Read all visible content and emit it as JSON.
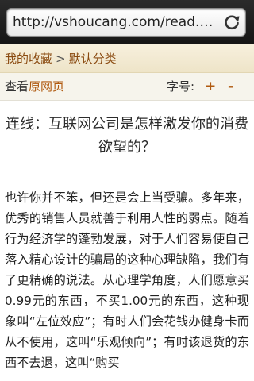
{
  "browser": {
    "url": "http://vshoucang.com/read.php?sid...",
    "reload_icon": "reload-icon"
  },
  "breadcrumb": {
    "home": "我的收藏",
    "separator": ">",
    "current": "默认分类"
  },
  "toolbar": {
    "view_prefix": "查看",
    "view_link": "原网页",
    "font_size_label": "字号:",
    "increase": "+",
    "decrease": "-"
  },
  "article": {
    "title": "连线：互联网公司是怎样激发你的消费欲望的？",
    "body": "也许你并不笨，但还是会上当受骗。多年来，优秀的销售人员就善于利用人性的弱点。随着行为经济学的蓬勃发展，对于人们容易使自己落入精心设计的骗局的这种心理缺陷，我们有了更精确的说法。从心理学角度，人们愿意买0.99元的东西，不买1.00元的东西，这种现象叫“左位效应”；有时人们会花钱办健身卡而从不使用，这叫“乐观倾向”；有时该退货的东西不去退，这叫“购买"
  },
  "colors": {
    "link": "#8a4a10",
    "accent": "#b05a10",
    "breadcrumb_bg": "#f3ead2",
    "urlbar_bg": "#1e1e1e"
  }
}
